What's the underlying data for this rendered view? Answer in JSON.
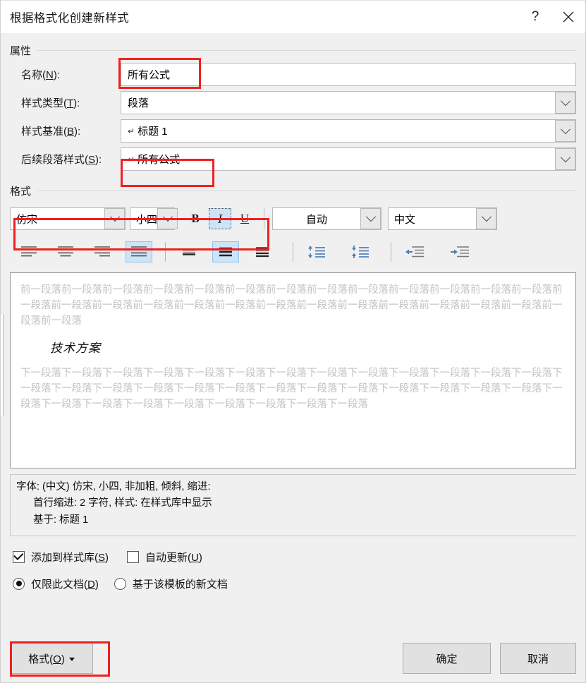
{
  "titlebar": {
    "title": "根据格式化创建新样式",
    "help_label": "?",
    "close_label": "×"
  },
  "properties": {
    "group_label": "属性",
    "name": {
      "label_main": "名称(",
      "label_key": "N",
      "label_end": "):",
      "value": "所有公式"
    },
    "style_type": {
      "label_main": "样式类型(",
      "label_key": "T",
      "label_end": "):",
      "value": "段落"
    },
    "style_based_on": {
      "label_main": "样式基准(",
      "label_key": "B",
      "label_end": "):",
      "value": "标题 1",
      "mark": "↵"
    },
    "next_style": {
      "label_main": "后续段落样式(",
      "label_key": "S",
      "label_end": "):",
      "value": "所有公式",
      "mark": "↵"
    }
  },
  "format": {
    "group_label": "格式",
    "font_name": "仿宋",
    "font_size": "小四",
    "bold_label": "B",
    "italic_label": "I",
    "underline_label": "U",
    "font_color": "自动",
    "language": "中文",
    "align_buttons": [
      "align-left",
      "align-center",
      "align-right",
      "align-justify"
    ],
    "spacing_buttons": [
      "line-spacing-single",
      "line-spacing-1-5",
      "line-spacing-double"
    ],
    "space_buttons": [
      "increase-paragraph-spacing",
      "decrease-paragraph-spacing"
    ],
    "indent_buttons": [
      "decrease-indent",
      "increase-indent"
    ],
    "active_align_index": 3,
    "active_spacing_index": 1,
    "italic_active": true
  },
  "preview": {
    "before_text": "前一段落前一段落前一段落前一段落前一段落前一段落前一段落前一段落前一段落前一段落前一段落前一段落前一段落前一段落前一段落前一段落前一段落前一段落前一段落前一段落前一段落前一段落前一段落前一段落前一段落前一段落前一段落前一段落",
    "sample_text": "技术方案",
    "after_text": "下一段落下一段落下一段落下一段落下一段落下一段落下一段落下一段落下一段落下一段落下一段落下一段落下一段落下一段落下一段落下一段落下一段落下一段落下一段落下一段落下一段落下一段落下一段落下一段落下一段落下一段落下一段落下一段落下一段落下一段落下一段落下一段落下一段落下一段落下一段落"
  },
  "description": {
    "line1": "字体: (中文) 仿宋, 小四, 非加粗, 倾斜, 缩进:",
    "line2": "首行缩进:  2 字符, 样式: 在样式库中显示",
    "line3": "基于: 标题 1"
  },
  "options": {
    "add_to_gallery": {
      "label_main": "添加到样式库(",
      "label_key": "S",
      "label_end": ")",
      "checked": true
    },
    "auto_update": {
      "label_main": "自动更新(",
      "label_key": "U",
      "label_end": ")",
      "checked": false
    },
    "only_this_doc": {
      "label_main": "仅限此文档(",
      "label_key": "D",
      "label_end": ")",
      "selected": true
    },
    "new_docs_from_template": {
      "label_main": "基于该模板的新文档",
      "label_key": "",
      "label_end": "",
      "selected": false
    }
  },
  "footer": {
    "format_button": {
      "label_main": "格式(",
      "label_key": "O",
      "label_end": ")"
    },
    "ok_button": "确定",
    "cancel_button": "取消"
  },
  "colors": {
    "annotation_red": "#f02020",
    "selection_blue": "#cce4f7",
    "dialog_bg": "#f0f0f0",
    "icon_blue": "#4a7ebb"
  }
}
